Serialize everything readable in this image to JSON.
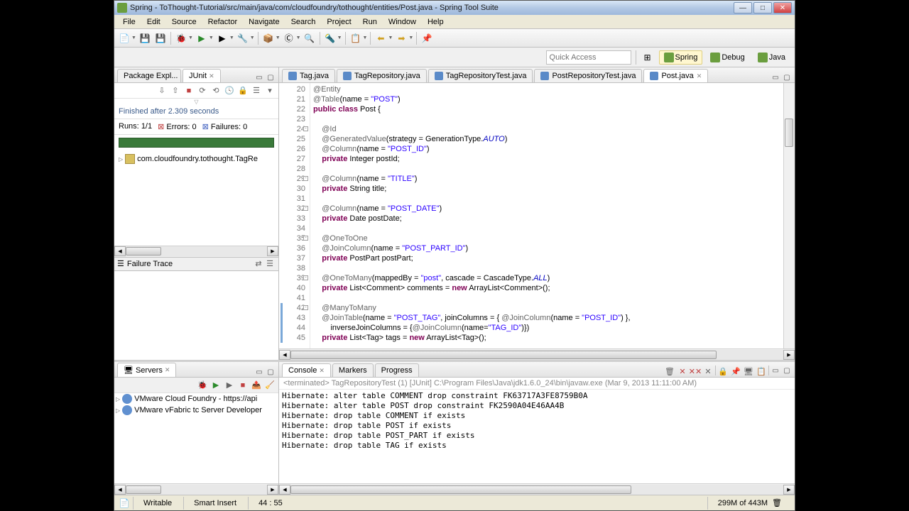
{
  "title": "Spring - ToThought-Tutorial/src/main/java/com/cloudfoundry/tothought/entities/Post.java - Spring Tool Suite",
  "menu": [
    "File",
    "Edit",
    "Source",
    "Refactor",
    "Navigate",
    "Search",
    "Project",
    "Run",
    "Window",
    "Help"
  ],
  "quick_access_placeholder": "Quick Access",
  "perspectives": [
    {
      "label": "Spring",
      "active": true
    },
    {
      "label": "Debug",
      "active": false
    },
    {
      "label": "Java",
      "active": false
    }
  ],
  "left_tabs": [
    {
      "label": "Package Expl...",
      "active": false
    },
    {
      "label": "JUnit",
      "active": true
    }
  ],
  "junit": {
    "finished": "Finished after 2.309 seconds",
    "runs_label": "Runs:",
    "runs": "1/1",
    "errors_label": "Errors:",
    "errors": "0",
    "failures_label": "Failures:",
    "failures": "0",
    "tree_item": "com.cloudfoundry.tothought.TagRe",
    "failure_trace": "Failure Trace"
  },
  "editor_tabs": [
    {
      "label": "Tag.java",
      "active": false
    },
    {
      "label": "TagRepository.java",
      "active": false
    },
    {
      "label": "TagRepositoryTest.java",
      "active": false
    },
    {
      "label": "PostRepositoryTest.java",
      "active": false
    },
    {
      "label": "Post.java",
      "active": true
    }
  ],
  "code_start_line": 20,
  "code_lines": [
    {
      "n": 20,
      "html": "<span class='ann'>@Entity</span>"
    },
    {
      "n": 21,
      "html": "<span class='ann'>@Table</span>(name = <span class='str'>\"POST\"</span>)"
    },
    {
      "n": 22,
      "html": "<span class='kw'>public</span> <span class='kw'>class</span> Post {"
    },
    {
      "n": 23,
      "html": ""
    },
    {
      "n": 24,
      "fold": true,
      "html": "    <span class='ann'>@Id</span>"
    },
    {
      "n": 25,
      "html": "    <span class='ann'>@GeneratedValue</span>(strategy = GenerationType.<span class='stat'>AUTO</span>)"
    },
    {
      "n": 26,
      "html": "    <span class='ann'>@Column</span>(name = <span class='str'>\"POST_ID\"</span>)"
    },
    {
      "n": 27,
      "html": "    <span class='kw'>private</span> Integer postId;"
    },
    {
      "n": 28,
      "html": ""
    },
    {
      "n": 29,
      "fold": true,
      "html": "    <span class='ann'>@Column</span>(name = <span class='str'>\"TITLE\"</span>)"
    },
    {
      "n": 30,
      "html": "    <span class='kw'>private</span> String title;"
    },
    {
      "n": 31,
      "html": ""
    },
    {
      "n": 32,
      "fold": true,
      "html": "    <span class='ann'>@Column</span>(name = <span class='str'>\"POST_DATE\"</span>)"
    },
    {
      "n": 33,
      "html": "    <span class='kw'>private</span> Date postDate;"
    },
    {
      "n": 34,
      "html": ""
    },
    {
      "n": 35,
      "fold": true,
      "html": "    <span class='ann'>@OneToOne</span>"
    },
    {
      "n": 36,
      "html": "    <span class='ann'>@JoinColumn</span>(name = <span class='str'>\"POST_PART_ID\"</span>)"
    },
    {
      "n": 37,
      "html": "    <span class='kw'>private</span> PostPart postPart;"
    },
    {
      "n": 38,
      "html": ""
    },
    {
      "n": 39,
      "fold": true,
      "html": "    <span class='ann'>@OneToMany</span>(mappedBy = <span class='str'>\"post\"</span>, cascade = CascadeType.<span class='stat'>ALL</span>)"
    },
    {
      "n": 40,
      "html": "    <span class='kw'>private</span> List&lt;Comment&gt; comments = <span class='kw'>new</span> ArrayList&lt;Comment&gt;();"
    },
    {
      "n": 41,
      "html": ""
    },
    {
      "n": 42,
      "fold": true,
      "change": true,
      "html": "    <span class='ann'>@ManyToMany</span>"
    },
    {
      "n": 43,
      "change": true,
      "html": "    <span class='ann'>@JoinTable</span>(name = <span class='str'>\"POST_TAG\"</span>, joinColumns = { <span class='ann'>@JoinColumn</span>(name = <span class='str'>\"POST_ID\"</span>) },"
    },
    {
      "n": 44,
      "change": true,
      "html": "        inverseJoinColumns = {<span class='ann'>@JoinColumn</span>(name=<span class='str'>\"TAG_ID\"</span>)})"
    },
    {
      "n": 45,
      "change": true,
      "html": "    <span class='kw'>private</span> List&lt;Tag&gt; tags = <span class='kw'>new</span> ArrayList&lt;Tag&gt;();"
    }
  ],
  "servers": {
    "tab": "Servers",
    "items": [
      "VMware Cloud Foundry - https://api",
      "VMware vFabric tc Server Developer"
    ]
  },
  "console": {
    "tabs": [
      {
        "label": "Console",
        "active": true
      },
      {
        "label": "Markers",
        "active": false
      },
      {
        "label": "Progress",
        "active": false
      }
    ],
    "header": "<terminated> TagRepositoryTest (1) [JUnit] C:\\Program Files\\Java\\jdk1.6.0_24\\bin\\javaw.exe (Mar 9, 2013 11:11:00 AM)",
    "lines": [
      "Hibernate: alter table COMMENT drop constraint FK63717A3FE8759B0A",
      "Hibernate: alter table POST drop constraint FK2590A04E46AA4B",
      "Hibernate: drop table COMMENT if exists",
      "Hibernate: drop table POST if exists",
      "Hibernate: drop table POST_PART if exists",
      "Hibernate: drop table TAG if exists"
    ]
  },
  "status": {
    "writable": "Writable",
    "insert": "Smart Insert",
    "pos": "44 : 55",
    "heap": "299M of 443M"
  }
}
